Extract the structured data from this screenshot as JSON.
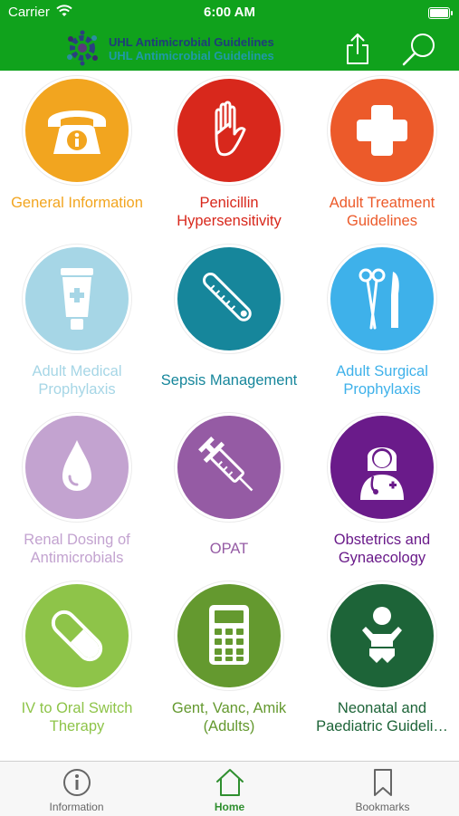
{
  "status_bar": {
    "carrier": "Carrier",
    "time": "6:00 AM"
  },
  "header": {
    "logo_line1": "UHL Antimicrobial Guidelines",
    "logo_line2": "UHL Antimicrobial Guidelines",
    "color": "#10a21c"
  },
  "tiles": [
    {
      "label": "General Information",
      "color": "#f2a51f",
      "label_color": "#f2a51f",
      "icon": "phone-info-icon"
    },
    {
      "label": "Penicillin Hypersensitivity",
      "color": "#d8281c",
      "label_color": "#d8281c",
      "icon": "hand-icon"
    },
    {
      "label": "Adult Treatment Guidelines",
      "color": "#ec5a2a",
      "label_color": "#ec5a2a",
      "icon": "cross-icon"
    },
    {
      "label": "Adult Medical Prophylaxis",
      "color": "#a6d6e6",
      "label_color": "#a6d6e6",
      "icon": "ointment-tube-icon"
    },
    {
      "label": "Sepsis Management",
      "color": "#16869b",
      "label_color": "#16869b",
      "icon": "thermometer-icon"
    },
    {
      "label": "Adult Surgical Prophylaxis",
      "color": "#3eb1ea",
      "label_color": "#3eb1ea",
      "icon": "surgical-tools-icon"
    },
    {
      "label": "Renal Dosing of Antimicrobials",
      "color": "#c3a3d0",
      "label_color": "#c3a3d0",
      "icon": "drop-icon"
    },
    {
      "label": "OPAT",
      "color": "#955ba4",
      "label_color": "#955ba4",
      "icon": "syringe-icon"
    },
    {
      "label": "Obstetrics and Gynaecology",
      "color": "#6a1b8a",
      "label_color": "#6a1b8a",
      "icon": "doctor-icon"
    },
    {
      "label": "IV to Oral Switch Therapy",
      "color": "#8ec449",
      "label_color": "#8ec449",
      "icon": "pill-icon"
    },
    {
      "label": "Gent, Vanc, Amik (Adults)",
      "color": "#64992f",
      "label_color": "#64992f",
      "icon": "calculator-icon"
    },
    {
      "label": "Neonatal and Paediatric Guideli…",
      "color": "#1d6438",
      "label_color": "#1d6438",
      "icon": "baby-icon"
    }
  ],
  "tabs": [
    {
      "label": "Information",
      "icon": "info-icon",
      "active": false
    },
    {
      "label": "Home",
      "icon": "home-icon",
      "active": true
    },
    {
      "label": "Bookmarks",
      "icon": "bookmark-icon",
      "active": false
    }
  ]
}
